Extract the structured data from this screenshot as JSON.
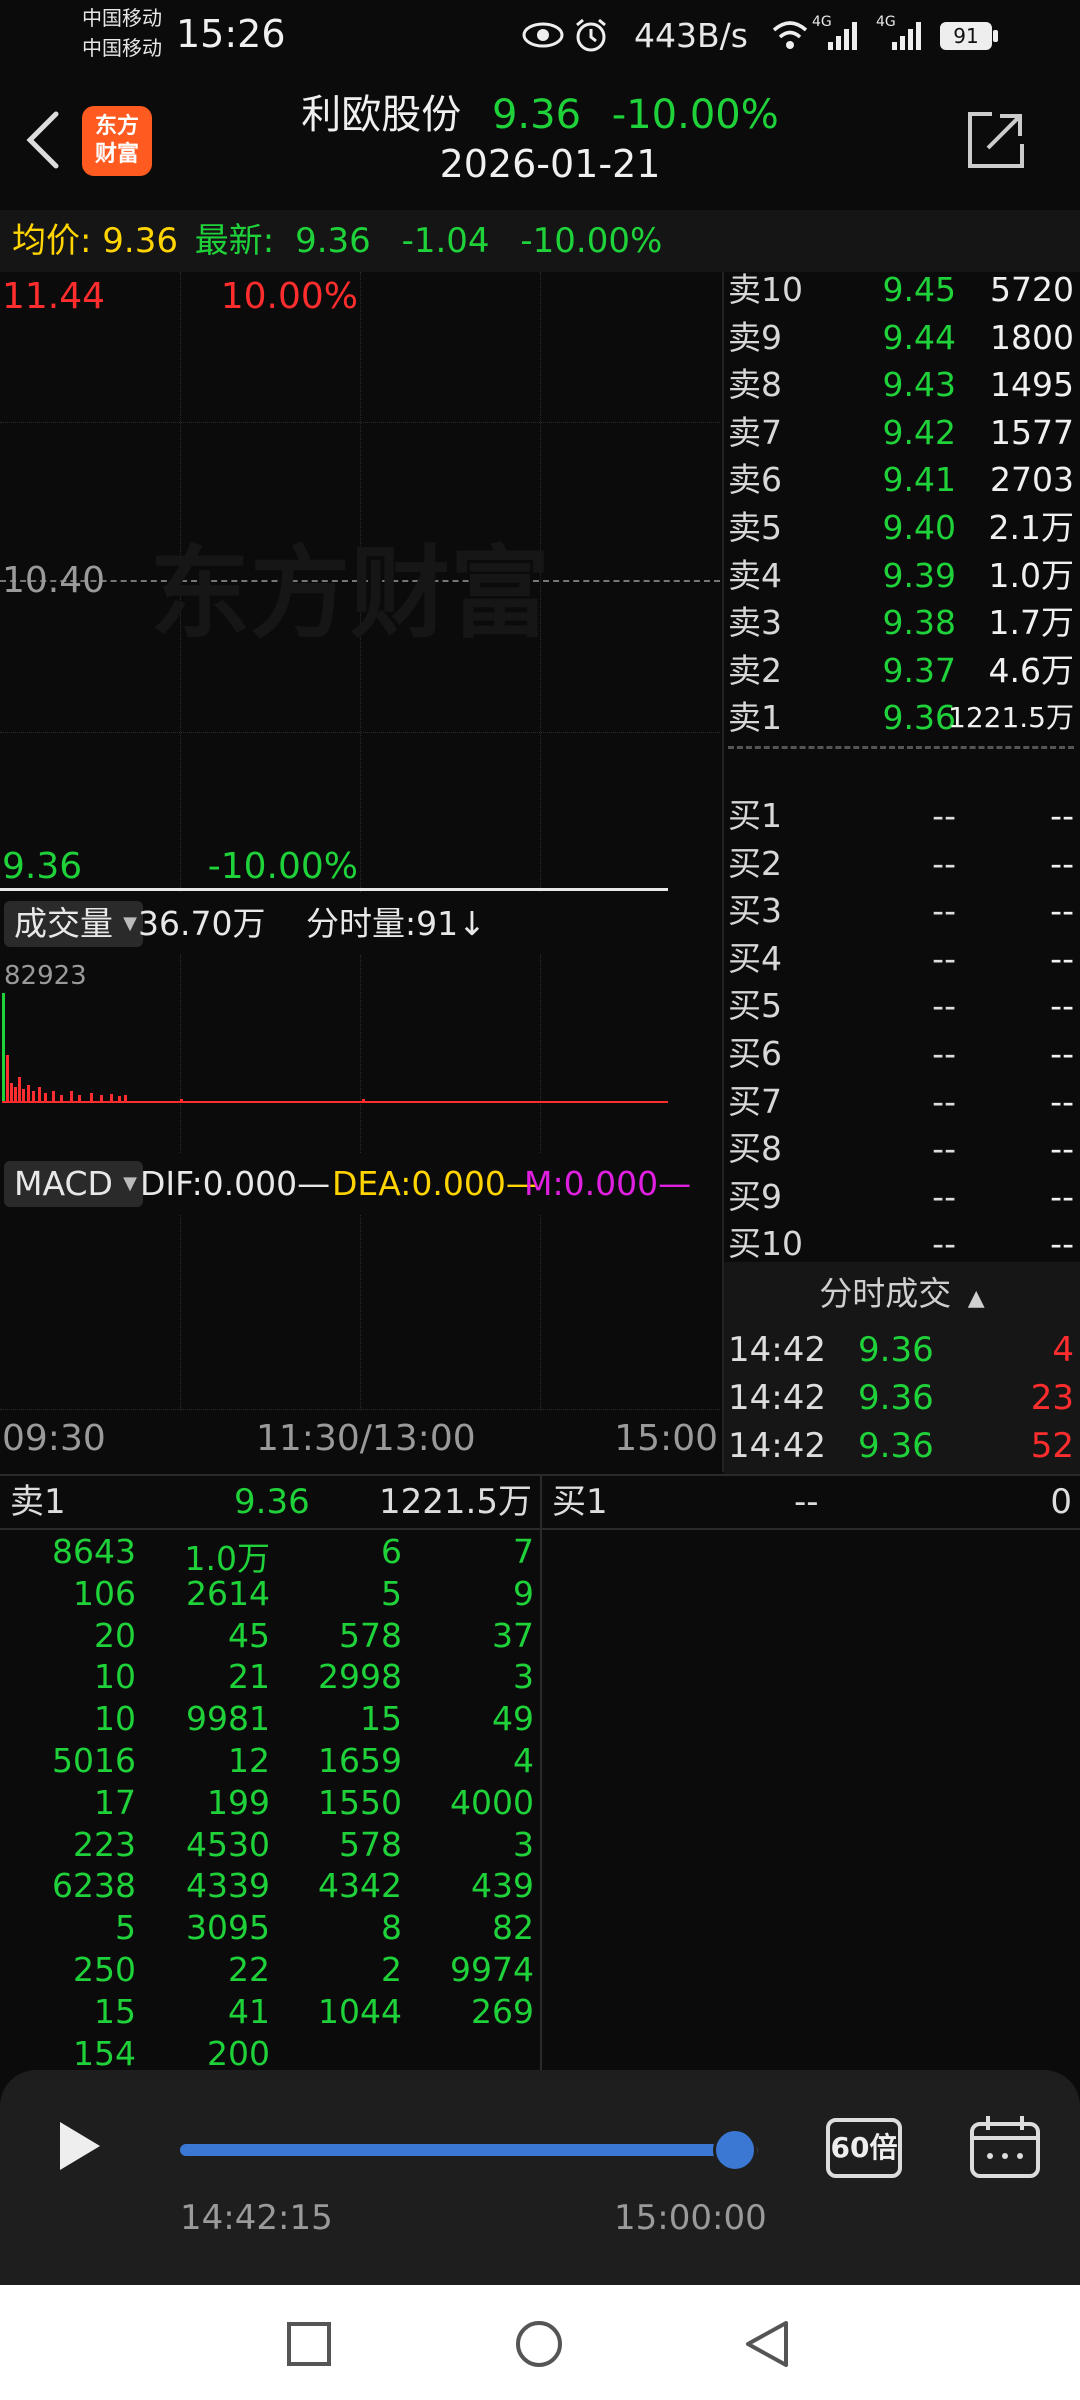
{
  "status": {
    "carrier1": "中国移动",
    "carrier2": "中国移动",
    "time": "15:26",
    "speed": "443B/s",
    "net1": "4G",
    "net2": "4G",
    "battery": "91"
  },
  "header": {
    "logo_line1": "东方",
    "logo_line2": "财富",
    "stock_name": "利欧股份",
    "price": "9.36",
    "change_pct": "-10.00%",
    "date": "2026-01-21"
  },
  "avgbar": {
    "avg_label": "均价:",
    "avg_value": "9.36",
    "latest_label": "最新:",
    "latest_value": "9.36",
    "change": "-1.04",
    "change_pct": "-10.00%"
  },
  "chart": {
    "top_price": "11.44",
    "top_pct": "10.00%",
    "mid_price": "10.40",
    "bottom_price": "9.36",
    "bottom_pct": "-10.00%",
    "watermark": "东方财富",
    "volume_selector": "成交量",
    "volume_total": "36.70万",
    "volume_tick": "分时量:91↓",
    "volume_max": "82923",
    "macd_selector": "MACD",
    "dif": "DIF:0.000—",
    "dea": "DEA:0.000—",
    "m": "M:0.000—",
    "time_start": "09:30",
    "time_mid": "11:30/13:00",
    "time_end": "15:00"
  },
  "orderbook": {
    "sell": [
      {
        "label": "卖10",
        "price": "9.45",
        "vol": "5720"
      },
      {
        "label": "卖9",
        "price": "9.44",
        "vol": "1800"
      },
      {
        "label": "卖8",
        "price": "9.43",
        "vol": "1495"
      },
      {
        "label": "卖7",
        "price": "9.42",
        "vol": "1577"
      },
      {
        "label": "卖6",
        "price": "9.41",
        "vol": "2703"
      },
      {
        "label": "卖5",
        "price": "9.40",
        "vol": "2.1万"
      },
      {
        "label": "卖4",
        "price": "9.39",
        "vol": "1.0万"
      },
      {
        "label": "卖3",
        "price": "9.38",
        "vol": "1.7万"
      },
      {
        "label": "卖2",
        "price": "9.37",
        "vol": "4.6万"
      },
      {
        "label": "卖1",
        "price": "9.36",
        "vol": "1221.5万"
      }
    ],
    "buy": [
      {
        "label": "买1",
        "price": "--",
        "vol": "--"
      },
      {
        "label": "买2",
        "price": "--",
        "vol": "--"
      },
      {
        "label": "买3",
        "price": "--",
        "vol": "--"
      },
      {
        "label": "买4",
        "price": "--",
        "vol": "--"
      },
      {
        "label": "买5",
        "price": "--",
        "vol": "--"
      },
      {
        "label": "买6",
        "price": "--",
        "vol": "--"
      },
      {
        "label": "买7",
        "price": "--",
        "vol": "--"
      },
      {
        "label": "买8",
        "price": "--",
        "vol": "--"
      },
      {
        "label": "买9",
        "price": "--",
        "vol": "--"
      },
      {
        "label": "买10",
        "price": "--",
        "vol": "--"
      }
    ]
  },
  "ticks": {
    "header": "分时成交",
    "rows": [
      {
        "time": "14:42",
        "price": "9.36",
        "vol": "4"
      },
      {
        "time": "14:42",
        "price": "9.36",
        "vol": "23"
      },
      {
        "time": "14:42",
        "price": "9.36",
        "vol": "52"
      }
    ]
  },
  "queue": {
    "sell_label": "卖1",
    "sell_price": "9.36",
    "sell_vol": "1221.5万",
    "buy_label": "买1",
    "buy_price": "--",
    "buy_vol": "0",
    "cells": [
      [
        "8643",
        "1.0万",
        "6",
        "7"
      ],
      [
        "106",
        "2614",
        "5",
        "9"
      ],
      [
        "20",
        "45",
        "578",
        "37"
      ],
      [
        "10",
        "21",
        "2998",
        "3"
      ],
      [
        "10",
        "9981",
        "15",
        "49"
      ],
      [
        "5016",
        "12",
        "1659",
        "4"
      ],
      [
        "17",
        "199",
        "1550",
        "4000"
      ],
      [
        "223",
        "4530",
        "578",
        "3"
      ],
      [
        "6238",
        "4339",
        "4342",
        "439"
      ],
      [
        "5",
        "3095",
        "8",
        "82"
      ],
      [
        "250",
        "22",
        "2",
        "9974"
      ],
      [
        "15",
        "41",
        "1044",
        "269"
      ],
      [
        "154",
        "200"
      ]
    ]
  },
  "player": {
    "current_time": "14:42:15",
    "end_time": "15:00:00",
    "progress": 0.96,
    "speed_label": "60倍"
  },
  "colors": {
    "up": "#ff2d2d",
    "down": "#1fd23a",
    "avg": "#ffd400",
    "accent": "#3a78d4"
  }
}
